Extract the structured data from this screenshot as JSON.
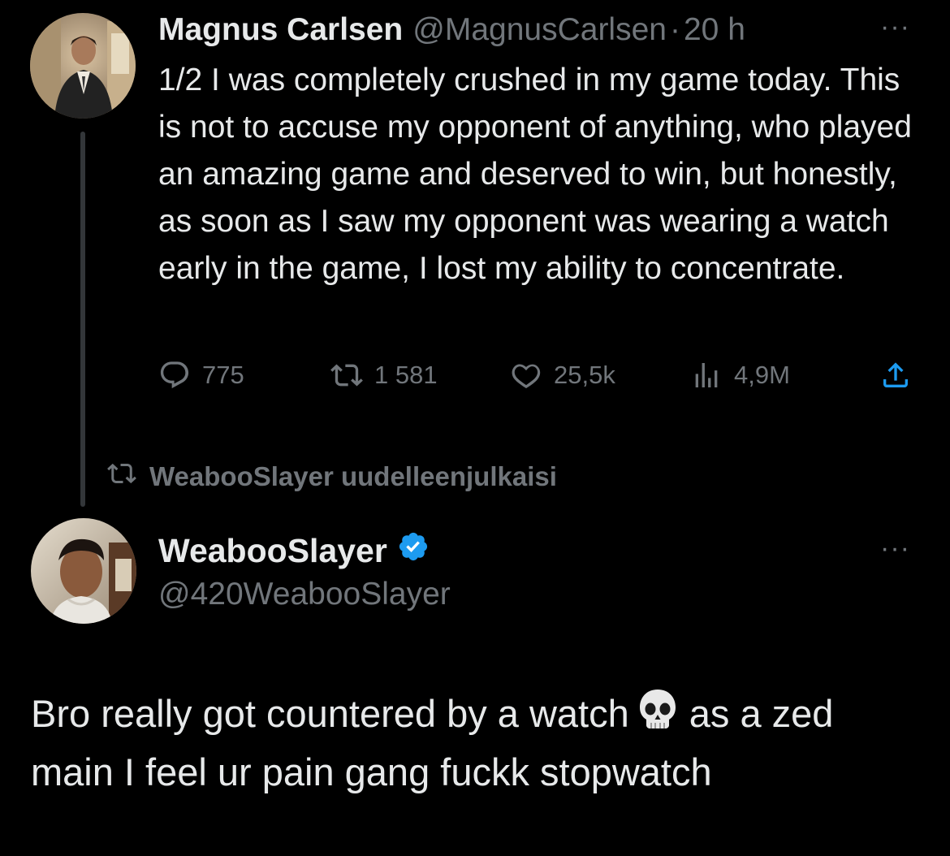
{
  "original_tweet": {
    "author_name": "Magnus Carlsen",
    "author_handle": "@MagnusCarlsen",
    "separator": "·",
    "time_ago": "20 h",
    "more_label": "···",
    "text": "1/2 I was completely crushed in my game today. This is not to accuse my opponent of anything, who played an amazing game and deserved to win, but honestly, as soon as I saw my opponent was wearing a watch early in the game, I lost my ability to concentrate.",
    "stats": {
      "replies": "775",
      "retweets": "1 581",
      "likes": "25,5k",
      "views": "4,9M"
    },
    "icons": [
      "reply-icon",
      "retweet-icon",
      "like-icon",
      "views-icon",
      "share-icon"
    ]
  },
  "retweet_indicator": {
    "text": "WeabooSlayer uudelleenjulkaisi",
    "icon": "retweet-icon"
  },
  "reply_tweet": {
    "author_name": "WeabooSlayer",
    "author_handle": "@420WeabooSlayer",
    "verified": true,
    "more_label": "···",
    "text_part1": "Bro really got countered by a watch",
    "emoji": "skull-emoji",
    "text_part2": "as a zed main I feel ur pain gang fuckk stopwatch"
  },
  "colors": {
    "background": "#000000",
    "primary_text": "#e7e9ea",
    "secondary_text": "#71767b",
    "verified_blue": "#1d9bf0",
    "thread_line": "#333639"
  }
}
